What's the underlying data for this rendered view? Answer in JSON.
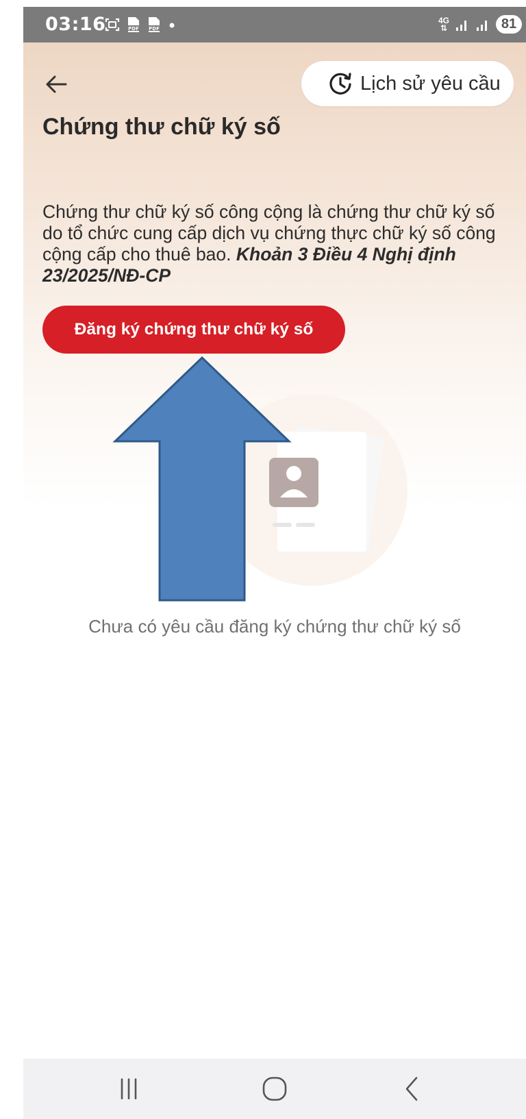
{
  "status_bar": {
    "time": "03:16",
    "network": "4G",
    "battery": "81",
    "icons": [
      "screenshot-icon",
      "pdf-icon",
      "pdf-icon",
      "dot-icon",
      "signal-icon",
      "signal-icon"
    ]
  },
  "header": {
    "back_icon": "arrow-left-icon",
    "history_icon": "history-clock-icon",
    "history_label": "Lịch sử yêu cầu"
  },
  "page": {
    "title": "Chứng thư chữ ký số",
    "description": "Chứng thư chữ ký số công cộng là chứng thư chữ ký số do tổ chức cung cấp dịch vụ chứng thực chữ ký số công cộng cấp cho thuê bao. ",
    "legal_reference": "Khoản 3 Điều 4 Nghị định 23/2025/NĐ-CP",
    "register_button": "Đăng ký chứng thư chữ ký số",
    "empty_state": "Chưa có yêu cầu đăng ký chứng thư chữ ký số"
  },
  "annotation": {
    "arrow_color": "#4f81bd"
  },
  "colors": {
    "accent": "#d61f26"
  },
  "nav_bar": {
    "icons": [
      "recents-icon",
      "home-icon",
      "back-icon"
    ]
  }
}
